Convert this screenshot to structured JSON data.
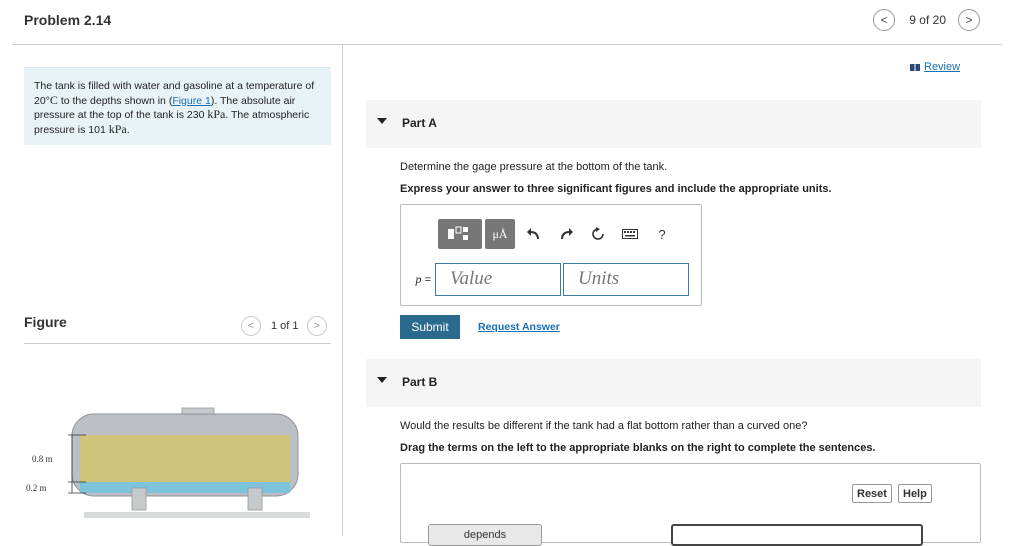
{
  "header": {
    "title": "Problem 2.14",
    "counter": "9 of 20",
    "prev_glyph": "<",
    "next_glyph": ">"
  },
  "problem": {
    "t1": "The tank is filled with water and gasoline at a temperature of 20",
    "deg": "°",
    "unitC": "C",
    "t2": " to the depths shown in (",
    "link": "Figure 1",
    "t3": "). The absolute air pressure at the top of the tank is 230 ",
    "kpa1": "kPa",
    "t4": ". The atmospheric pressure is 101 ",
    "kpa2": "kPa",
    "t5": "."
  },
  "figure": {
    "label": "Figure",
    "counter": "1 of 1",
    "dim_top": "0.8 m",
    "dim_bottom": "0.2 m",
    "colors": {
      "gasoline": "#cfc47a",
      "water": "#7ec3dc",
      "tank": "#bcc0c4"
    }
  },
  "review": {
    "label": "Review"
  },
  "partA": {
    "label": "Part A",
    "question": "Determine the gage pressure at the bottom of the tank.",
    "instruction": "Express your answer to three significant figures and include the appropriate units.",
    "toolbar": {
      "mu": "μÅ",
      "help": "?"
    },
    "var": "p",
    "equals": " =",
    "value_placeholder": "Value",
    "units_placeholder": "Units",
    "submit": "Submit",
    "request": "Request Answer"
  },
  "partB": {
    "label": "Part B",
    "question": "Would the results be different if the tank had a flat bottom rather than a curved one?",
    "instruction": "Drag the terms on the left to the appropriate blanks on the right to complete the sentences.",
    "reset": "Reset",
    "help": "Help",
    "chip": "depends"
  }
}
